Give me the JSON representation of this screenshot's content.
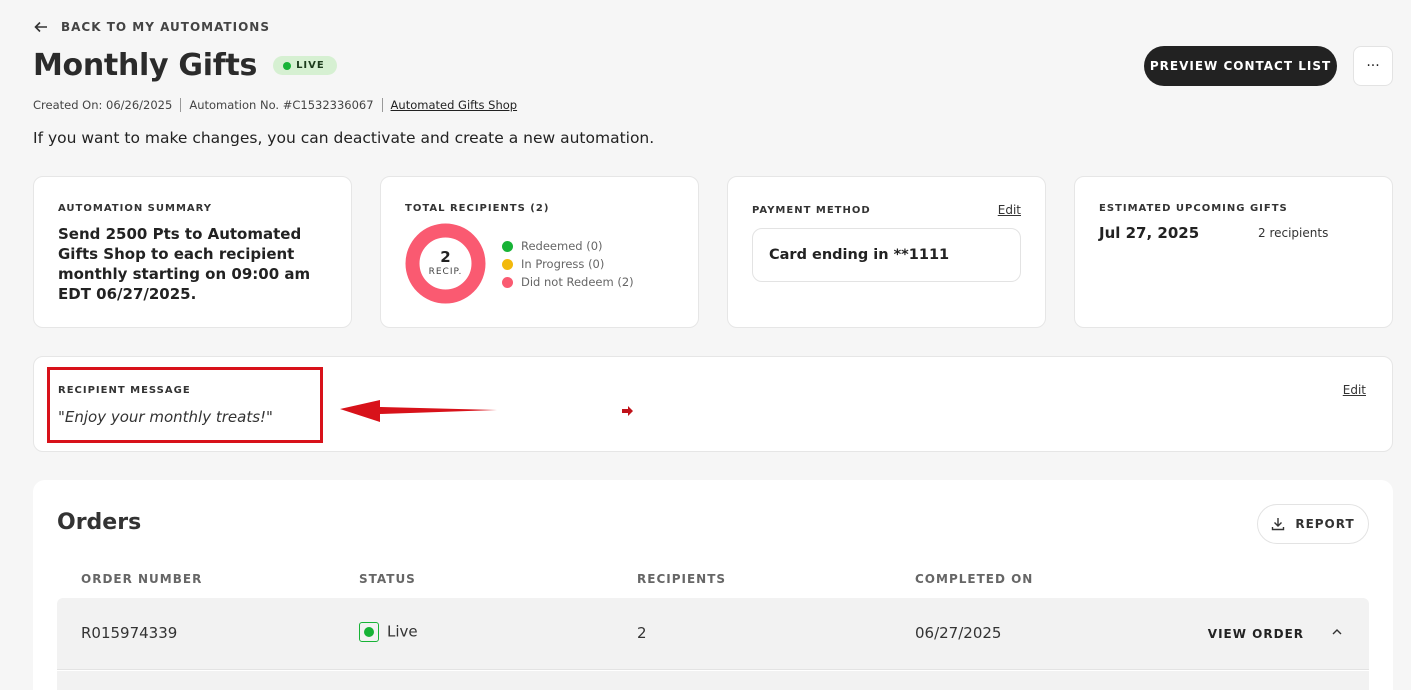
{
  "header": {
    "back_label": "BACK TO MY AUTOMATIONS",
    "title": "Monthly Gifts",
    "status_badge": "LIVE",
    "created_on": "Created On: 06/26/2025",
    "automation_no": "Automation No. #C1532336067",
    "shop_link": "Automated Gifts Shop",
    "notice": "If you want to make changes, you can deactivate and create a new automation.",
    "preview_button": "PREVIEW CONTACT LIST",
    "more_button": "···"
  },
  "summary": {
    "label": "AUTOMATION SUMMARY",
    "text": "Send 2500 Pts to Automated Gifts Shop to each recipient monthly starting on 09:00 am EDT 06/27/2025."
  },
  "recipients": {
    "label": "TOTAL RECIPIENTS (2)",
    "count": "2",
    "count_label": "RECIP.",
    "legend": [
      {
        "label": "Redeemed (0)",
        "color": "#17b336"
      },
      {
        "label": "In Progress (0)",
        "color": "#f2b90c"
      },
      {
        "label": "Did not Redeem (2)",
        "color": "#fa5a71"
      }
    ],
    "donut_color": "#fa5a71"
  },
  "payment": {
    "label": "PAYMENT METHOD",
    "edit": "Edit",
    "card": "Card ending in **1111"
  },
  "upcoming": {
    "label": "ESTIMATED UPCOMING GIFTS",
    "date": "Jul 27, 2025",
    "count": "2 recipients"
  },
  "message": {
    "label": "RECIPIENT MESSAGE",
    "text": "\"Enjoy your monthly treats!\"",
    "edit": "Edit"
  },
  "orders": {
    "title": "Orders",
    "report_button": "REPORT",
    "columns": [
      "ORDER NUMBER",
      "STATUS",
      "RECIPIENTS",
      "COMPLETED ON"
    ],
    "rows": [
      {
        "order_number": "R015974339",
        "status": "Live",
        "recipients": "2",
        "completed_on": "06/27/2025",
        "action": "VIEW ORDER"
      }
    ]
  },
  "colors": {
    "accent_dark": "#222222",
    "live_green": "#17b336",
    "annotation_red": "#d8121a"
  }
}
